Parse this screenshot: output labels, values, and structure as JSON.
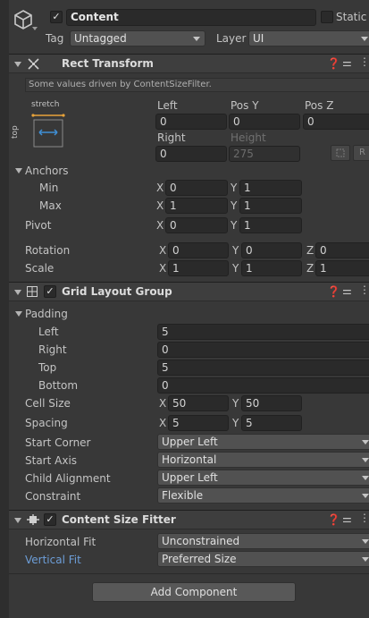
{
  "header": {
    "object_name": "Content",
    "static_label": "Static",
    "tag_label": "Tag",
    "tag_value": "Untagged",
    "layer_label": "Layer",
    "layer_value": "UI"
  },
  "rect_transform": {
    "title": "Rect Transform",
    "notice": "Some values driven by ContentSizeFilter.",
    "preset_h": "stretch",
    "preset_v": "top",
    "left_label": "Left",
    "left_value": "0",
    "posy_label": "Pos Y",
    "posy_value": "0",
    "posz_label": "Pos Z",
    "posz_value": "0",
    "right_label": "Right",
    "right_value": "0",
    "height_label": "Height",
    "height_value": "275",
    "r_button": "R",
    "anchors_label": "Anchors",
    "min_label": "Min",
    "min_x": "0",
    "min_y": "1",
    "max_label": "Max",
    "max_x": "1",
    "max_y": "1",
    "pivot_label": "Pivot",
    "pivot_x": "0",
    "pivot_y": "1",
    "rotation_label": "Rotation",
    "rot_x": "0",
    "rot_y": "0",
    "rot_z": "0",
    "scale_label": "Scale",
    "scale_x": "1",
    "scale_y": "1",
    "scale_z": "1",
    "axis_x": "X",
    "axis_y": "Y",
    "axis_z": "Z"
  },
  "grid_layout": {
    "title": "Grid Layout Group",
    "padding_label": "Padding",
    "left_label": "Left",
    "left_value": "5",
    "right_label": "Right",
    "right_value": "0",
    "top_label": "Top",
    "top_value": "5",
    "bottom_label": "Bottom",
    "bottom_value": "0",
    "cell_size_label": "Cell Size",
    "cell_x": "50",
    "cell_y": "50",
    "spacing_label": "Spacing",
    "spacing_x": "5",
    "spacing_y": "5",
    "start_corner_label": "Start Corner",
    "start_corner_value": "Upper Left",
    "start_axis_label": "Start Axis",
    "start_axis_value": "Horizontal",
    "child_alignment_label": "Child Alignment",
    "child_alignment_value": "Upper Left",
    "constraint_label": "Constraint",
    "constraint_value": "Flexible"
  },
  "content_size_fitter": {
    "title": "Content Size Fitter",
    "horizontal_fit_label": "Horizontal Fit",
    "horizontal_fit_value": "Unconstrained",
    "vertical_fit_label": "Vertical Fit",
    "vertical_fit_value": "Preferred Size"
  },
  "add_component_label": "Add Component",
  "colors": {
    "background": "#383838",
    "field": "#2a2a2a",
    "highlight_label": "#6d9ed8",
    "anchor_orange": "#e8a33a",
    "anchor_blue": "#3f8fd6"
  }
}
